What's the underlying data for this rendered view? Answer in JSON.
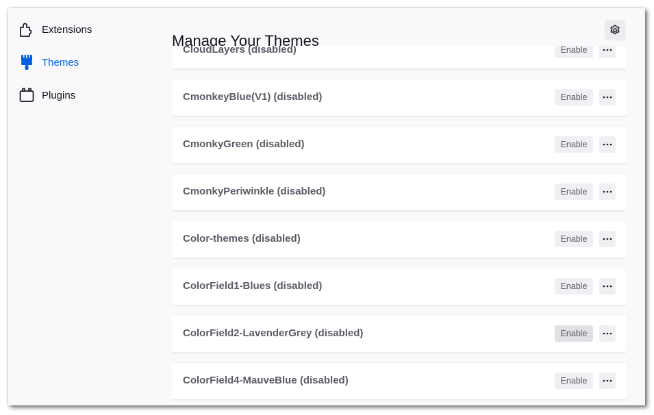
{
  "sidebar": {
    "items": [
      {
        "label": "Extensions",
        "icon": "puzzle-piece-icon",
        "selected": false
      },
      {
        "label": "Themes",
        "icon": "paintbrush-icon",
        "selected": true
      },
      {
        "label": "Plugins",
        "icon": "plugin-block-icon",
        "selected": false
      }
    ]
  },
  "header": {
    "title": "Manage Your Themes",
    "settings_icon": "gear-icon"
  },
  "themes": [
    {
      "name": "CloudLayers (disabled)",
      "action": "Enable"
    },
    {
      "name": "CmonkeyBlue(V1) (disabled)",
      "action": "Enable"
    },
    {
      "name": "CmonkyGreen (disabled)",
      "action": "Enable"
    },
    {
      "name": "CmonkyPeriwinkle (disabled)",
      "action": "Enable"
    },
    {
      "name": "Color-themes (disabled)",
      "action": "Enable"
    },
    {
      "name": "ColorField1-Blues (disabled)",
      "action": "Enable"
    },
    {
      "name": "ColorField2-LavenderGrey (disabled)",
      "action": "Enable"
    },
    {
      "name": "ColorField4-MauveBlue (disabled)",
      "action": "Enable"
    }
  ],
  "colors": {
    "accent": "#0061e0",
    "text": "#15141a",
    "muted_text": "#5b5b66",
    "background": "#f9f9fb",
    "card": "#ffffff"
  }
}
